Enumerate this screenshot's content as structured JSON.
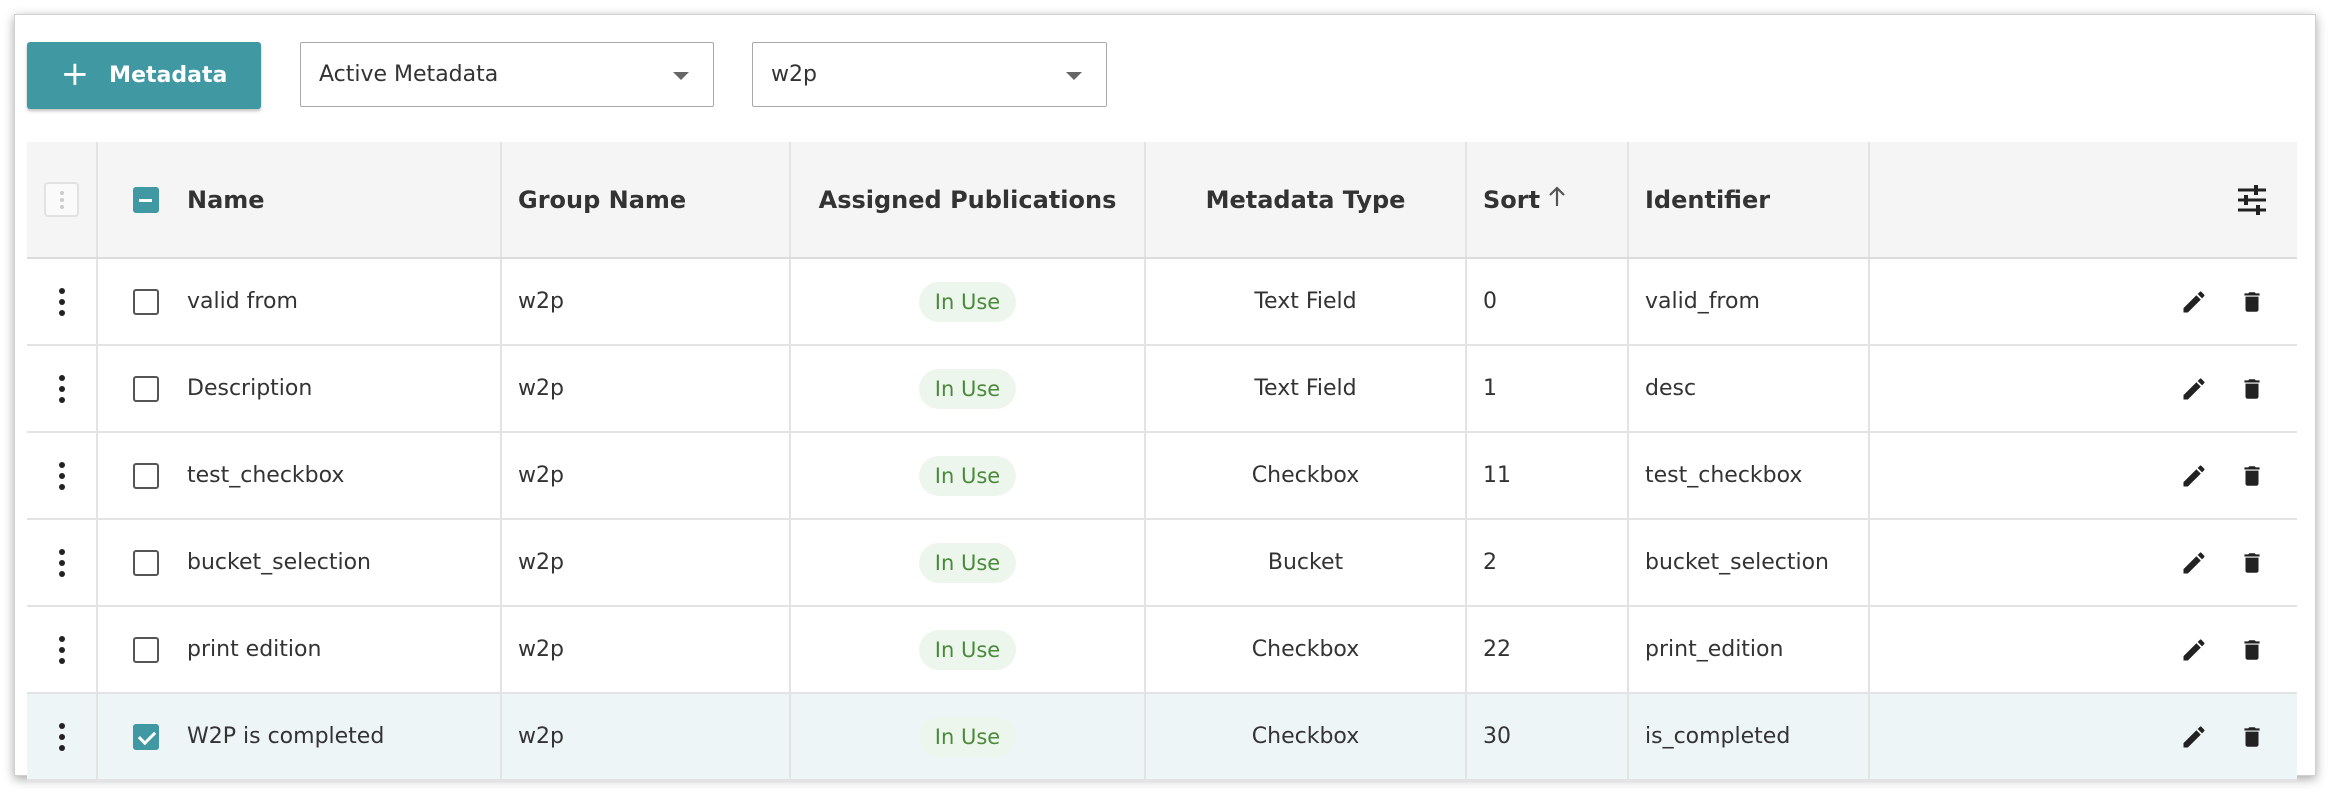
{
  "toolbar": {
    "add_button_label": "Metadata",
    "add_button_icon": "plus-icon",
    "status_filter": {
      "selected": "Active Metadata"
    },
    "group_filter": {
      "selected": "w2p"
    }
  },
  "colors": {
    "accent": "#3f98a2",
    "badge_bg": "#edf6ec",
    "badge_text": "#4a8a3b",
    "header_bg": "#f5f5f5",
    "selected_row_bg": "#eef5f7"
  },
  "table": {
    "columns": {
      "name": "Name",
      "group_name": "Group Name",
      "assigned_publications": "Assigned Publications",
      "metadata_type": "Metadata Type",
      "sort": "Sort",
      "identifier": "Identifier"
    },
    "sort_indicator": "ascending",
    "header_checkbox_state": "indeterminate",
    "rows": [
      {
        "name": "valid from",
        "group": "w2p",
        "publications": "In Use",
        "type": "Text Field",
        "sort": "0",
        "identifier": "valid_from",
        "checked": false
      },
      {
        "name": "Description",
        "group": "w2p",
        "publications": "In Use",
        "type": "Text Field",
        "sort": "1",
        "identifier": "desc",
        "checked": false
      },
      {
        "name": "test_checkbox",
        "group": "w2p",
        "publications": "In Use",
        "type": "Checkbox",
        "sort": "11",
        "identifier": "test_checkbox",
        "checked": false
      },
      {
        "name": "bucket_selection",
        "group": "w2p",
        "publications": "In Use",
        "type": "Bucket",
        "sort": "2",
        "identifier": "bucket_selection",
        "checked": false
      },
      {
        "name": "print edition",
        "group": "w2p",
        "publications": "In Use",
        "type": "Checkbox",
        "sort": "22",
        "identifier": "print_edition",
        "checked": false
      },
      {
        "name": "W2P is completed",
        "group": "w2p",
        "publications": "In Use",
        "type": "Checkbox",
        "sort": "30",
        "identifier": "is_completed",
        "checked": true
      }
    ]
  }
}
